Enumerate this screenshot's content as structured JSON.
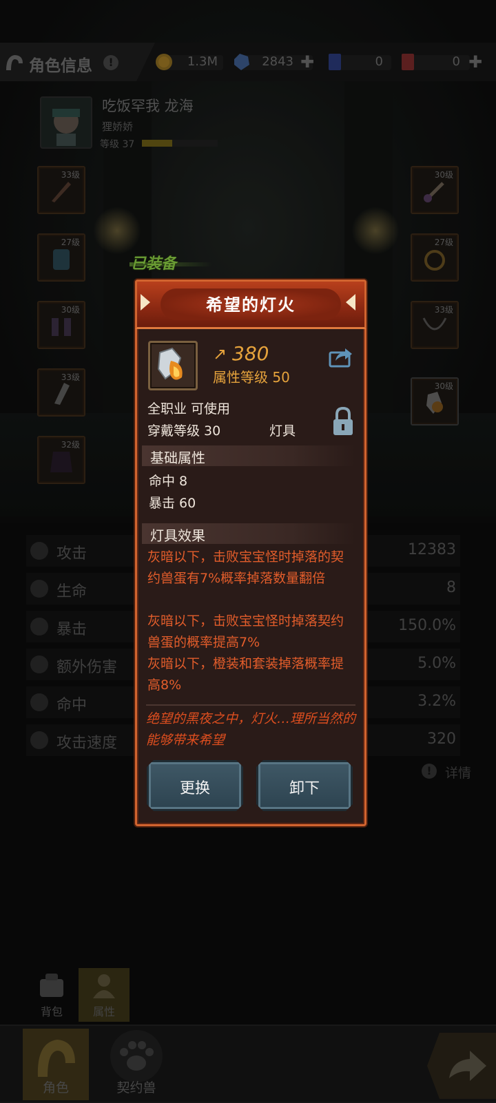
{
  "topbar": {
    "title": "角色信息",
    "info_icon": "!",
    "resources": [
      {
        "name": "gold",
        "icon": "gold-coin-icon",
        "value": "1.3M",
        "has_plus": false
      },
      {
        "name": "crystal",
        "icon": "crystal-icon",
        "value": "2843",
        "has_plus": true
      },
      {
        "name": "blue-card",
        "icon": "blue-card-icon",
        "value": "0",
        "has_plus": false
      },
      {
        "name": "red-card",
        "icon": "red-card-icon",
        "value": "0",
        "has_plus": true
      }
    ],
    "plus": "✚"
  },
  "profile": {
    "name": "吃饭罕我   龙海",
    "sub": "狸娇娇",
    "level_text": "等级 37",
    "level_progress": 0.4
  },
  "slots": {
    "left": [
      "33级",
      "27级",
      "30级",
      "33级",
      "32级"
    ],
    "right": [
      "30级",
      "27级",
      "33级",
      "30级"
    ]
  },
  "equipped_tag": "已装备",
  "stats": [
    {
      "label": "攻击",
      "value": "12383",
      "icon": "sword-icon"
    },
    {
      "label": "生命",
      "value": "8",
      "icon": "heart-icon"
    },
    {
      "label": "暴击",
      "value": "150.0%",
      "icon": "crit-icon"
    },
    {
      "label": "额外伤害",
      "value": "5.0%",
      "icon": "extra-damage-icon"
    },
    {
      "label": "命中",
      "value": "3.2%",
      "icon": "target-icon"
    },
    {
      "label": "攻击速度",
      "value": "320",
      "icon": "speed-icon"
    }
  ],
  "detail": {
    "icon": "!",
    "label": "详情"
  },
  "subtabs": [
    {
      "label": "背包",
      "active": false
    },
    {
      "label": "属性",
      "active": true
    }
  ],
  "navtabs": [
    {
      "label": "角色",
      "active": true
    },
    {
      "label": "契约兽",
      "active": false
    }
  ],
  "popup": {
    "title": "希望的灯火",
    "power_icon": "↗",
    "power": "380",
    "attr_level": "属性等级 50",
    "usable": "全职业 可使用",
    "wear_level": "穿戴等级 30",
    "item_type": "灯具",
    "base_header": "基础属性",
    "base_stats": [
      "命中  8",
      "暴击  60"
    ],
    "effect_header": "灯具效果",
    "effects": [
      "灰暗以下，击败宝宝怪时掉落的契约兽蛋有7%概率掉落数量翻倍",
      "灰暗以下，击败宝宝怪时掉落契约兽蛋的概率提高7%",
      "灰暗以下，橙装和套装掉落概率提高8%"
    ],
    "flavor": "绝望的黑夜之中，灯火…理所当然的能够带来希望",
    "buttons": {
      "replace": "更换",
      "unequip": "卸下"
    }
  },
  "colors": {
    "accent_orange": "#d1642f",
    "effect_red": "#e35d2b",
    "gold_text": "#e6a33c",
    "equipped_green": "#8ccf45",
    "button_blue": "#3f5866"
  }
}
